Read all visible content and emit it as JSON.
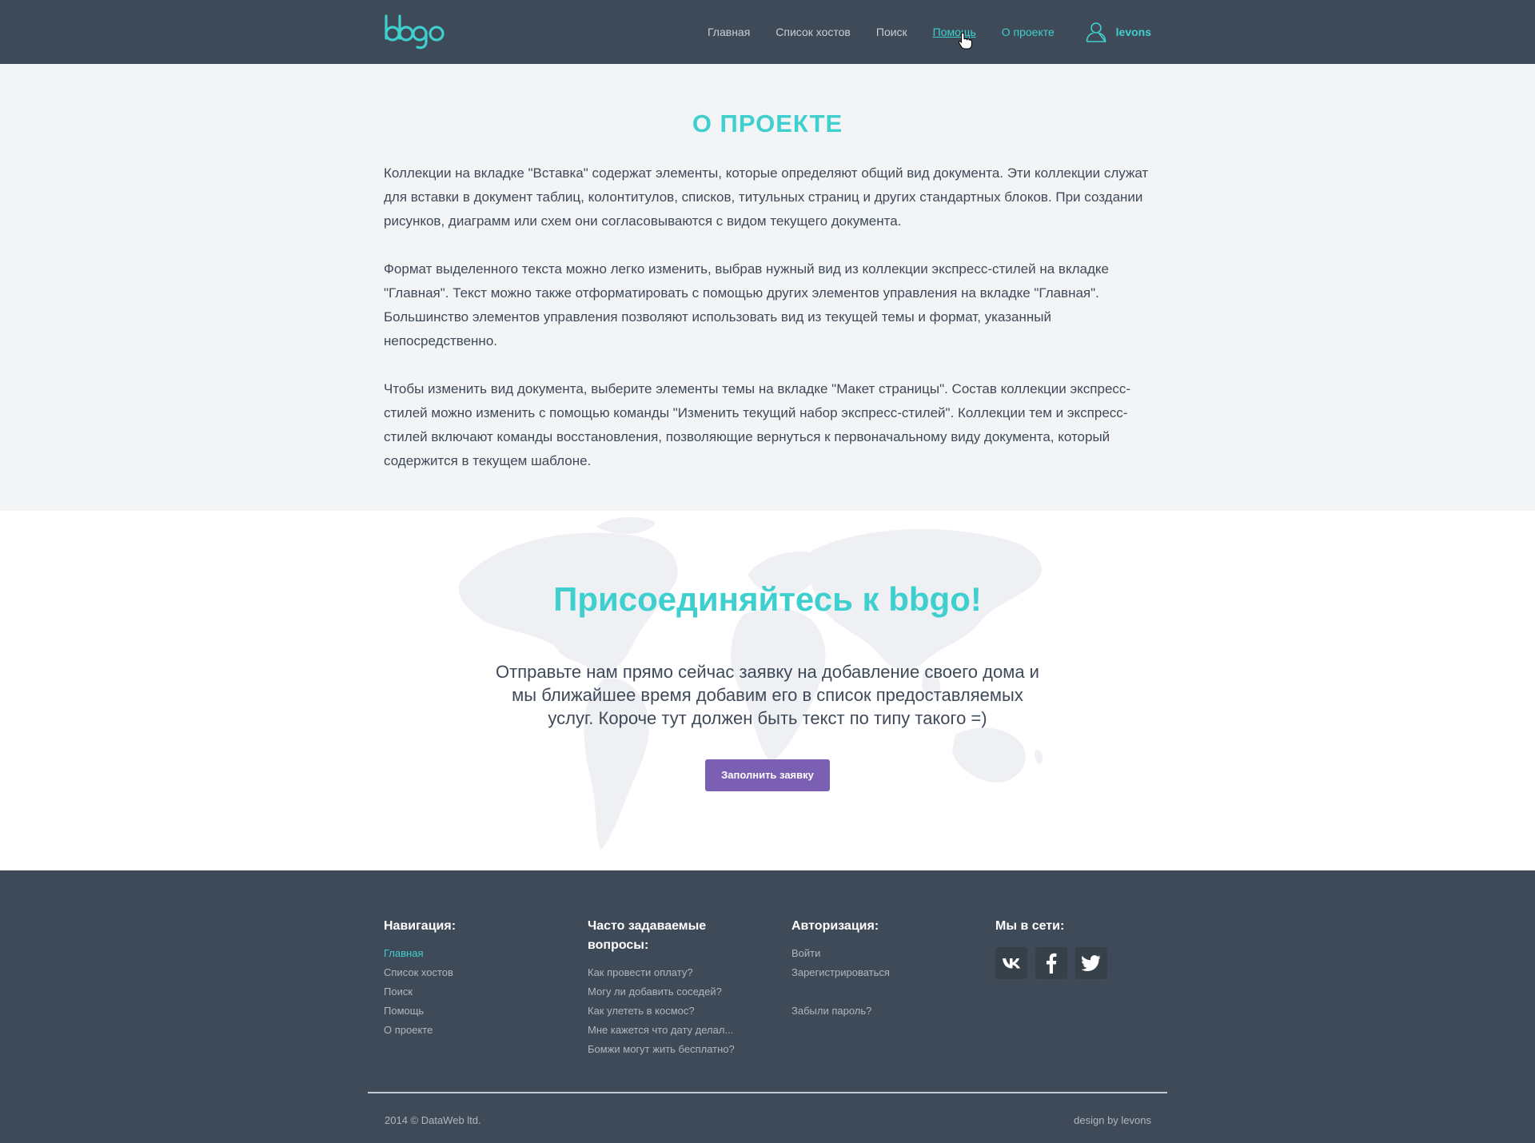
{
  "header": {
    "logo": "bbgo",
    "nav": [
      {
        "label": "Главная"
      },
      {
        "label": "Список хостов"
      },
      {
        "label": "Поиск"
      },
      {
        "label": "Помощь"
      },
      {
        "label": "О проекте"
      }
    ],
    "username": "levons"
  },
  "about": {
    "title": "О ПРОЕКТЕ",
    "paragraphs": [
      "Коллекции на вкладке \"Вставка\" содержат элементы, которые определяют общий вид документа. Эти коллекции служат для вставки в документ таблиц, колонтитулов, списков, титульных страниц и других стандартных блоков. При создании рисунков, диаграмм или схем они согласовываются с видом текущего документа.",
      "Формат выделенного текста можно легко изменить, выбрав нужный вид из коллекции экспресс-стилей на вкладке \"Главная\". Текст можно также отформатировать с помощью других элементов управления на вкладке \"Главная\". Большинство элементов управления позволяют использовать вид из текущей темы и формат, указанный непосредственно.",
      "Чтобы изменить вид документа, выберите элементы темы на вкладке \"Макет страницы\". Состав коллекции экспресс-стилей можно изменить с помощью команды \"Изменить текущий набор экспресс-стилей\". Коллекции тем и экспресс-стилей включают команды восстановления, позволяющие вернуться к первоначальному виду документа, который содержится в текущем шаблоне."
    ]
  },
  "join": {
    "title": "Присоединяйтесь к bbgo!",
    "text": "Отправьте нам прямо сейчас заявку на добавление своего дома и мы ближайшее время добавим его в список предоставляемых услуг. Короче тут должен быть текст по типу такого =)",
    "button": "Заполнить заявку"
  },
  "footer": {
    "nav_title": "Навигация:",
    "nav_links": [
      "Главная",
      "Список хостов",
      "Поиск",
      "Помощь",
      "О проекте"
    ],
    "faq_title": "Часто задаваемые вопросы:",
    "faq_links": [
      "Как провести оплату?",
      "Могу ли добавить соседей?",
      "Как улететь в космос?",
      "Мне кажется что дату делал...",
      "Бомжи могут жить бесплатно?"
    ],
    "auth_title": "Авторизация:",
    "auth_links": [
      "Войти",
      "Зарегистрироваться",
      "Забыли пароль?"
    ],
    "social_title": "Мы в сети:",
    "social": [
      "vk-icon",
      "facebook-icon",
      "twitter-icon"
    ],
    "copyright": "2014 © DataWeb ltd.",
    "design": "design by levons"
  },
  "colors": {
    "accent": "#3fcfcf",
    "dark": "#3f4a58",
    "button": "#7b5fb2",
    "light_bg": "#f3f4f6"
  }
}
